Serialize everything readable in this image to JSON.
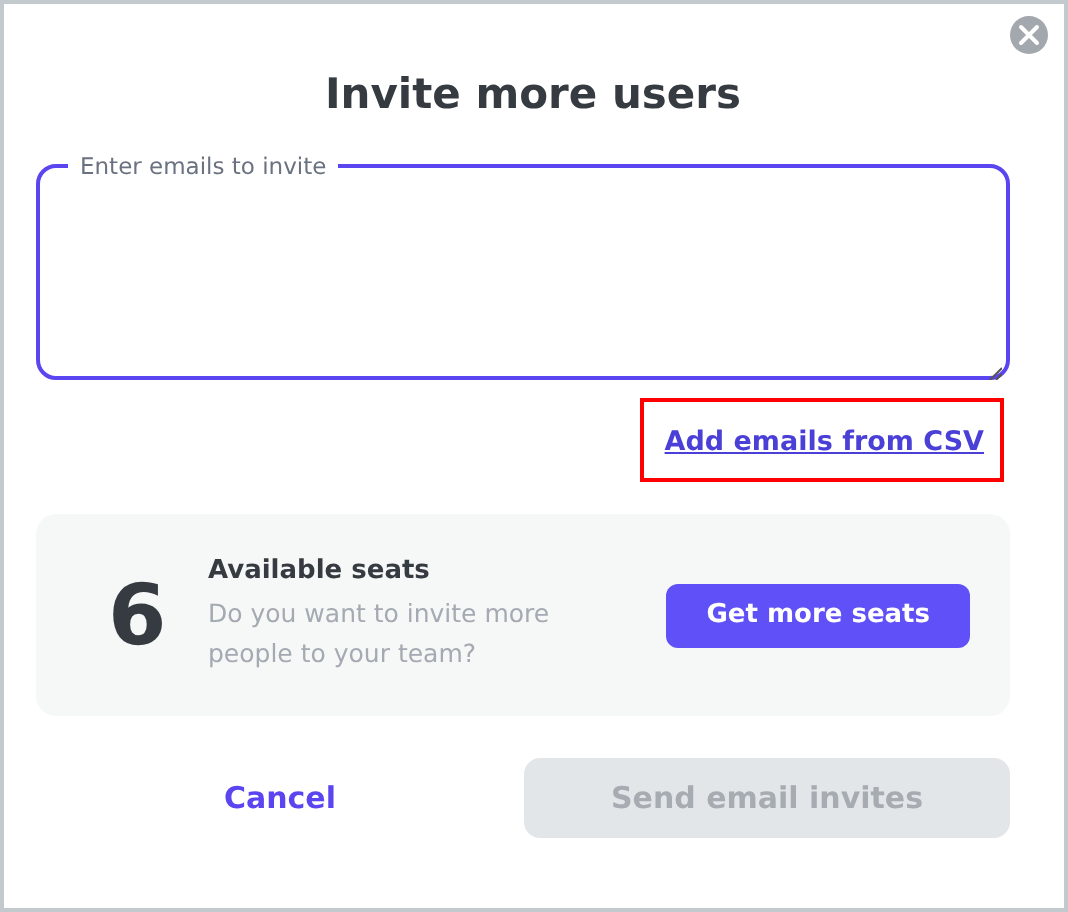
{
  "dialog": {
    "title": "Invite more users"
  },
  "email_field": {
    "label": "Enter emails to invite",
    "focused": true
  },
  "csv_link": {
    "label": "Add emails from CSV",
    "highlighted": true
  },
  "seats_card": {
    "count": "6",
    "title": "Available seats",
    "description": "Do you want to invite more people to your team?",
    "button": "Get more seats"
  },
  "footer": {
    "cancel": "Cancel",
    "submit": {
      "label": "Send email invites",
      "disabled": true
    }
  }
}
